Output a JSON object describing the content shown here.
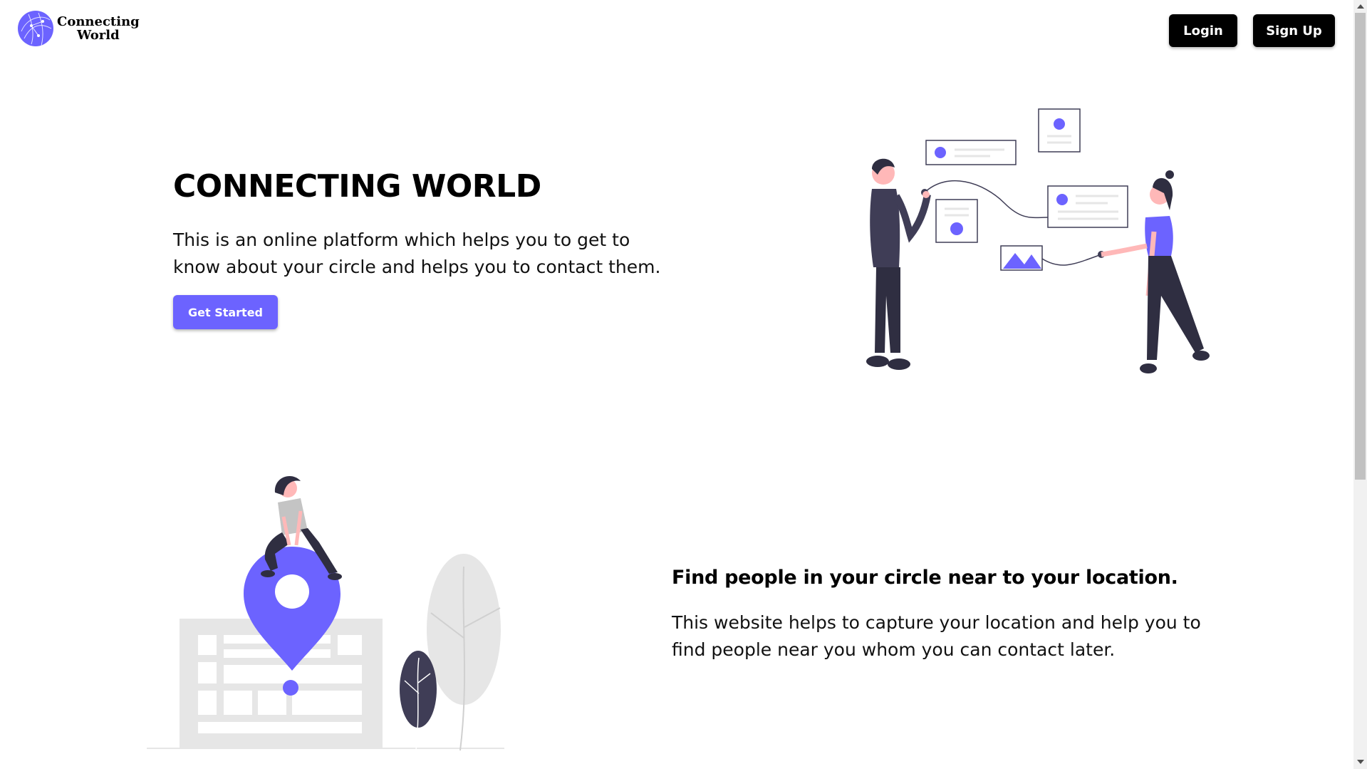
{
  "header": {
    "logo_line1": "Connecting",
    "logo_line2": "World",
    "login_label": "Login",
    "signup_label": "Sign Up"
  },
  "hero": {
    "title": "CONNECTING WORLD",
    "description": "This is an online platform which helps you to get to know about your circle and helps you to contact them.",
    "cta_label": "Get Started"
  },
  "section2": {
    "title": "Find people in your circle near to your location.",
    "description": "This website helps to capture your location and help you to find people near you whom you can contact later."
  },
  "colors": {
    "accent": "#6c63ff",
    "button_dark": "#000000",
    "illustration_gray": "#e6e6e6",
    "illustration_dark": "#3f3d56"
  },
  "icons": [
    "globe-logo-icon",
    "vertical-scrollbar"
  ]
}
